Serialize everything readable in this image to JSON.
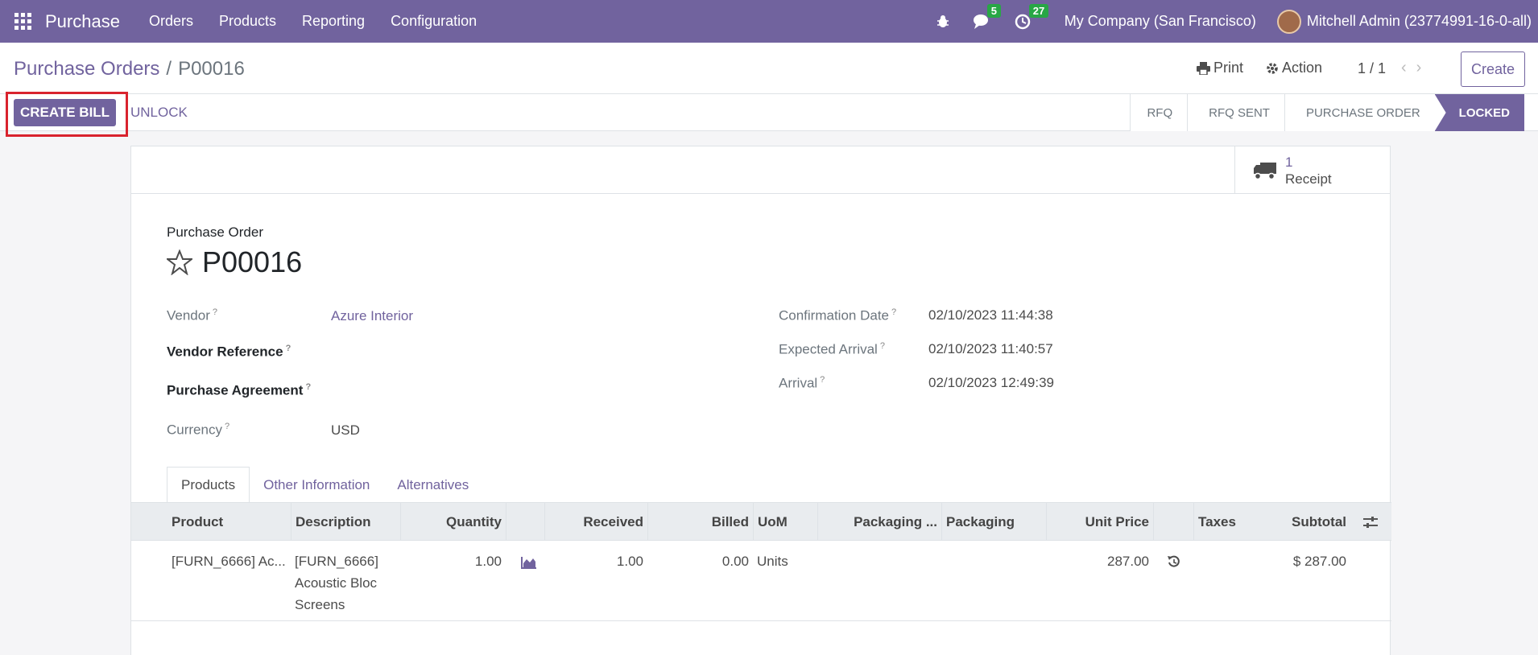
{
  "navbar": {
    "app_name": "Purchase",
    "menu": [
      "Orders",
      "Products",
      "Reporting",
      "Configuration"
    ],
    "messages_count": "5",
    "activities_count": "27",
    "company": "My Company (San Francisco)",
    "user": "Mitchell Admin (23774991-16-0-all)"
  },
  "control_panel": {
    "breadcrumb_parent": "Purchase Orders",
    "breadcrumb_separator": "/",
    "breadcrumb_current": "P00016",
    "print_label": "Print",
    "action_label": "Action",
    "pager": "1 / 1",
    "create_label": "Create"
  },
  "statusbar": {
    "create_bill_label": "CREATE BILL",
    "unlock_label": "UNLOCK",
    "stages": [
      "RFQ",
      "RFQ SENT",
      "PURCHASE ORDER",
      "LOCKED"
    ],
    "active_stage": "LOCKED"
  },
  "smart_button": {
    "receipt_count": "1",
    "receipt_label": "Receipt"
  },
  "form": {
    "title": "Purchase Order",
    "name": "P00016",
    "vendor_label": "Vendor",
    "vendor_value": "Azure Interior",
    "vendor_ref_label": "Vendor Reference",
    "agreement_label": "Purchase Agreement",
    "currency_label": "Currency",
    "currency_value": "USD",
    "confirmation_label": "Confirmation Date",
    "confirmation_value": "02/10/2023 11:44:38",
    "expected_label": "Expected Arrival",
    "expected_value": "02/10/2023 11:40:57",
    "arrival_label": "Arrival",
    "arrival_value": "02/10/2023 12:49:39",
    "help_mark": "?"
  },
  "tabs": [
    "Products",
    "Other Information",
    "Alternatives"
  ],
  "table": {
    "columns": [
      "Product",
      "Description",
      "Quantity",
      "",
      "Received",
      "Billed",
      "UoM",
      "Packaging ...",
      "Packaging",
      "Unit Price",
      "",
      "Taxes",
      "Subtotal"
    ],
    "rows": [
      {
        "product": "[FURN_6666] Ac...",
        "description_lines": [
          "[FURN_6666]",
          "Acoustic Bloc",
          "Screens"
        ],
        "quantity": "1.00",
        "received": "1.00",
        "billed": "0.00",
        "uom": "Units",
        "unit_price": "287.00",
        "subtotal": "$ 287.00"
      }
    ]
  },
  "colors": {
    "brand": "#71639e",
    "badge": "#28a745",
    "highlight": "#d9232e"
  }
}
